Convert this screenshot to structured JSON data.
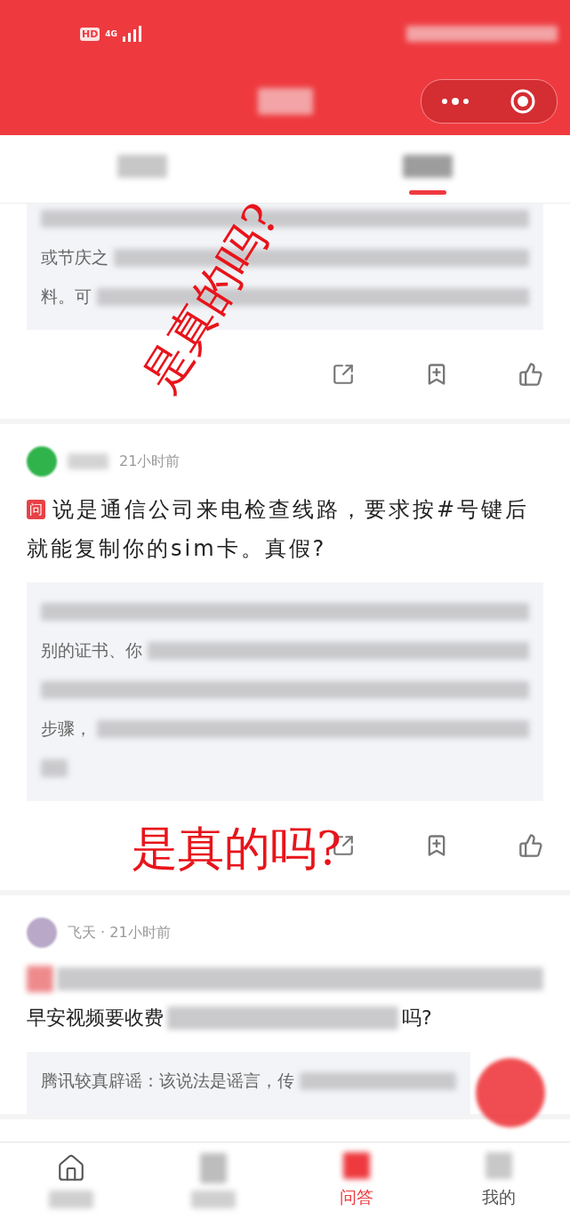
{
  "status_bar": {
    "hd": "HD",
    "network": "4G"
  },
  "tabs": [
    {
      "selected": false
    },
    {
      "selected": true
    }
  ],
  "posts": [
    {
      "answer_lines": [
        {
          "kind": "blurred"
        },
        {
          "kind": "partial",
          "text": "或节庆之"
        },
        {
          "kind": "partial",
          "text": "料。可"
        }
      ]
    },
    {
      "time": "21小时前",
      "badge": "问",
      "question": "说是通信公司来电检查线路，要求按#号键后就能复制你的sim卡。真假?",
      "answer_lines": [
        {
          "kind": "blurred"
        },
        {
          "kind": "partial",
          "text": "别的证书、你"
        },
        {
          "kind": "blurred"
        },
        {
          "kind": "partial",
          "text": "步骤，"
        },
        {
          "kind": "short"
        }
      ]
    },
    {
      "author": "飞天 · 21小时前",
      "question_lines": [
        {
          "kind": "blurred"
        },
        {
          "kind": "partial",
          "text": "早安视频要收费",
          "tail": "吗?"
        }
      ],
      "answer_lines": [
        {
          "kind": "partial",
          "text": "腾讯较真辟谣：该说法是谣言，传"
        }
      ]
    }
  ],
  "annotations": [
    "是真的吗?",
    "是真的吗?"
  ],
  "bottom_nav": [
    {
      "selected": false
    },
    {
      "selected": false
    },
    {
      "label": "问答",
      "selected": true
    },
    {
      "label": "我的",
      "selected": false
    }
  ]
}
